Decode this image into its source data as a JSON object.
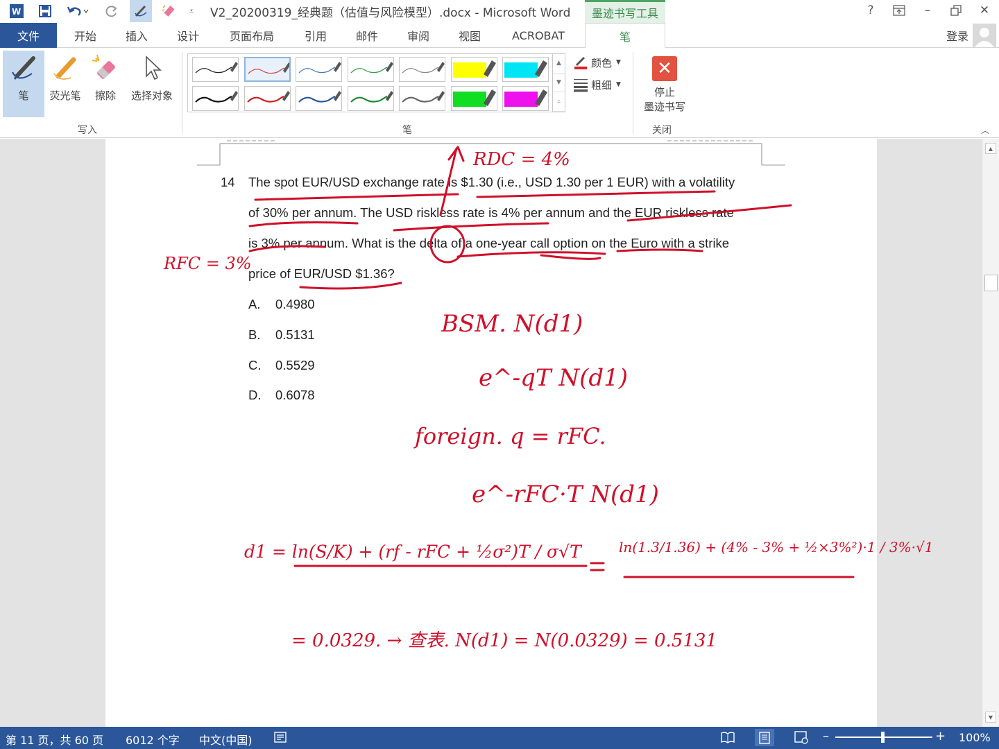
{
  "titlebar": {
    "doc_title": "V2_20200319_经典题（估值与风险模型）.docx - Microsoft Word",
    "context_tab": "墨迹书写工具",
    "help": "?",
    "restore_ribbon": "⊡",
    "minimize": "–",
    "restore": "🗗",
    "close": "✕"
  },
  "tabs": {
    "file": "文件",
    "items": [
      "开始",
      "插入",
      "设计",
      "页面布局",
      "引用",
      "邮件",
      "审阅",
      "视图",
      "ACROBAT"
    ],
    "pen": "笔",
    "login": "登录"
  },
  "ribbon": {
    "write_group": {
      "label": "写入",
      "tools": [
        "笔",
        "荧光笔",
        "擦除",
        "选择对象"
      ]
    },
    "pens_group": {
      "label": "笔",
      "color": "颜色",
      "thickness": "粗细",
      "swatch_colors_row1": [
        "#222222",
        "#d64545",
        "#4a7bbd",
        "#3a9a4a",
        "#888888",
        "#ffff00",
        "#00e5f5"
      ],
      "swatch_colors_row2": [
        "#111111",
        "#cc1f1f",
        "#2d5aa0",
        "#1f8a30",
        "#666666",
        "#11dd22",
        "#ee11ee"
      ]
    },
    "close_group": {
      "label": "关闭",
      "stop_line1": "停止",
      "stop_line2": "墨迹书写"
    }
  },
  "document": {
    "question_number": "14",
    "question_lines": [
      "The spot EUR/USD exchange rate is $1.30 (i.e., USD 1.30 per 1 EUR) with a volatility",
      "of 30% per annum. The USD riskless rate is 4% per annum and the EUR riskless rate",
      "is 3% per annum. What is the delta of a one-year call option on the Euro with a strike",
      "price of EUR/USD $1.36?"
    ],
    "options": [
      {
        "letter": "A.",
        "value": "0.4980"
      },
      {
        "letter": "B.",
        "value": "0.5131"
      },
      {
        "letter": "C.",
        "value": "0.5529"
      },
      {
        "letter": "D.",
        "value": "0.6078"
      }
    ],
    "ink_color": "#d0102a",
    "ink_annotations": {
      "rdc": "RDC = 4%",
      "rfc": "RFC = 3%",
      "bsm": "BSM. N(d1)",
      "exp_q": "e^-qT N(d1)",
      "foreign": "foreign. q = rFC.",
      "exp_rfc": "e^-rFC·T N(d1)",
      "d1_formula": "d1 = ln(S/K) + (rf - rFC + ½σ²)T / σ√T",
      "d1_subst": "ln(1.3/1.36) + (4% - 3% + ½×3%²)·1 / 3%·√1",
      "result": "= 0.0329. → 查表. N(d1) = N(0.0329) = 0.5131"
    }
  },
  "statusbar": {
    "page": "第 11 页，共 60 页",
    "words": "6012 个字",
    "language": "中文(中国)",
    "zoom": "100%"
  }
}
